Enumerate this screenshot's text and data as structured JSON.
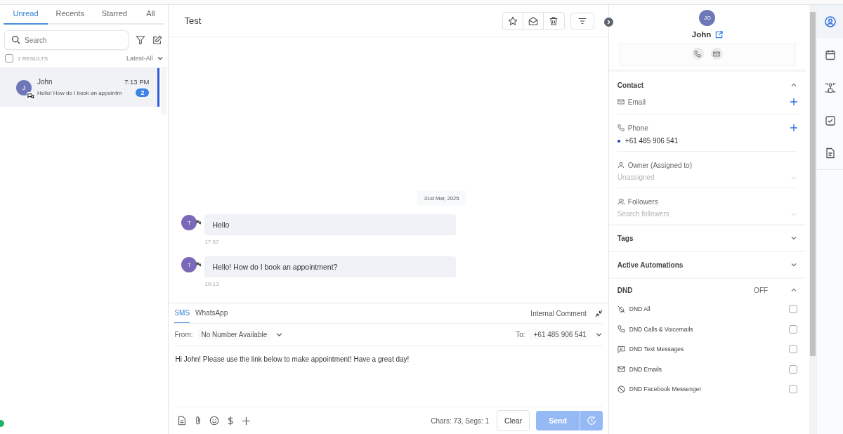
{
  "inbox": {
    "tabs": [
      {
        "label": "Unread",
        "selected": true
      },
      {
        "label": "Recents",
        "selected": false
      },
      {
        "label": "Starred",
        "selected": false
      },
      {
        "label": "All",
        "selected": false
      }
    ],
    "search": {
      "placeholder": "Search"
    },
    "select_all": {
      "checked": false
    },
    "results": "1 RESULTS",
    "sort": "Latest-All",
    "conversations": [
      {
        "avatar": "J",
        "name": "John",
        "time": "7:13 PM",
        "preview": "Hello! How do I book an appointm",
        "unread": "2",
        "selected": true
      }
    ]
  },
  "conversation": {
    "title": "Test",
    "date": "31st Mar, 2025",
    "messages": [
      {
        "avatar": "T",
        "text": "Hello",
        "time": "17:57"
      },
      {
        "avatar": "T",
        "text": "Hello! How do I book an appointment?",
        "time": "19:13"
      }
    ]
  },
  "composer": {
    "channels": [
      {
        "label": "SMS",
        "selected": true
      },
      {
        "label": "WhatsApp",
        "selected": false
      }
    ],
    "internal_comment": "Internal Comment",
    "from_label": "From:",
    "from_value": "No Number Available",
    "to_label": "To:",
    "to_value": "+61 485 906 541",
    "message": "Hi John! Please use the link below to make appointment! Have a great day!",
    "counter": "Chars: 73, Segs: 1",
    "clear": "Clear",
    "send": {
      "label": "Send",
      "disabled": true
    }
  },
  "contact": {
    "initials": "JO",
    "name": "John",
    "section": "Contact",
    "fields": [
      {
        "kind": "email",
        "label": "Email",
        "addable": true
      },
      {
        "kind": "phone",
        "label": "Phone",
        "addable": true,
        "value": "+61 485 906 541"
      },
      {
        "kind": "owner",
        "label": "Owner (Assigned to)",
        "placeholder": "Unassigned"
      },
      {
        "kind": "followers",
        "label": "Followers",
        "placeholder": "Search followers"
      }
    ],
    "collapsed_sections": [
      {
        "title": "Tags",
        "expanded": false
      },
      {
        "title": "Active Automations",
        "expanded": false
      }
    ],
    "dnd": {
      "title": "DND",
      "status": "OFF",
      "expanded": true,
      "options": [
        {
          "kind": "all",
          "label": "DND All",
          "checked": false
        },
        {
          "kind": "calls",
          "label": "DND Calls & Voicemails",
          "checked": false
        },
        {
          "kind": "text",
          "label": "DND Text Messages",
          "checked": false
        },
        {
          "kind": "email",
          "label": "DND Emails",
          "checked": false
        },
        {
          "kind": "facebook",
          "label": "DND Facebook Messenger",
          "checked": false
        }
      ]
    }
  },
  "rail": [
    {
      "kind": "person",
      "selected": true
    },
    {
      "kind": "calendar",
      "selected": false
    },
    {
      "kind": "network",
      "selected": false
    },
    {
      "kind": "task",
      "selected": false
    },
    {
      "kind": "document",
      "selected": false
    }
  ]
}
